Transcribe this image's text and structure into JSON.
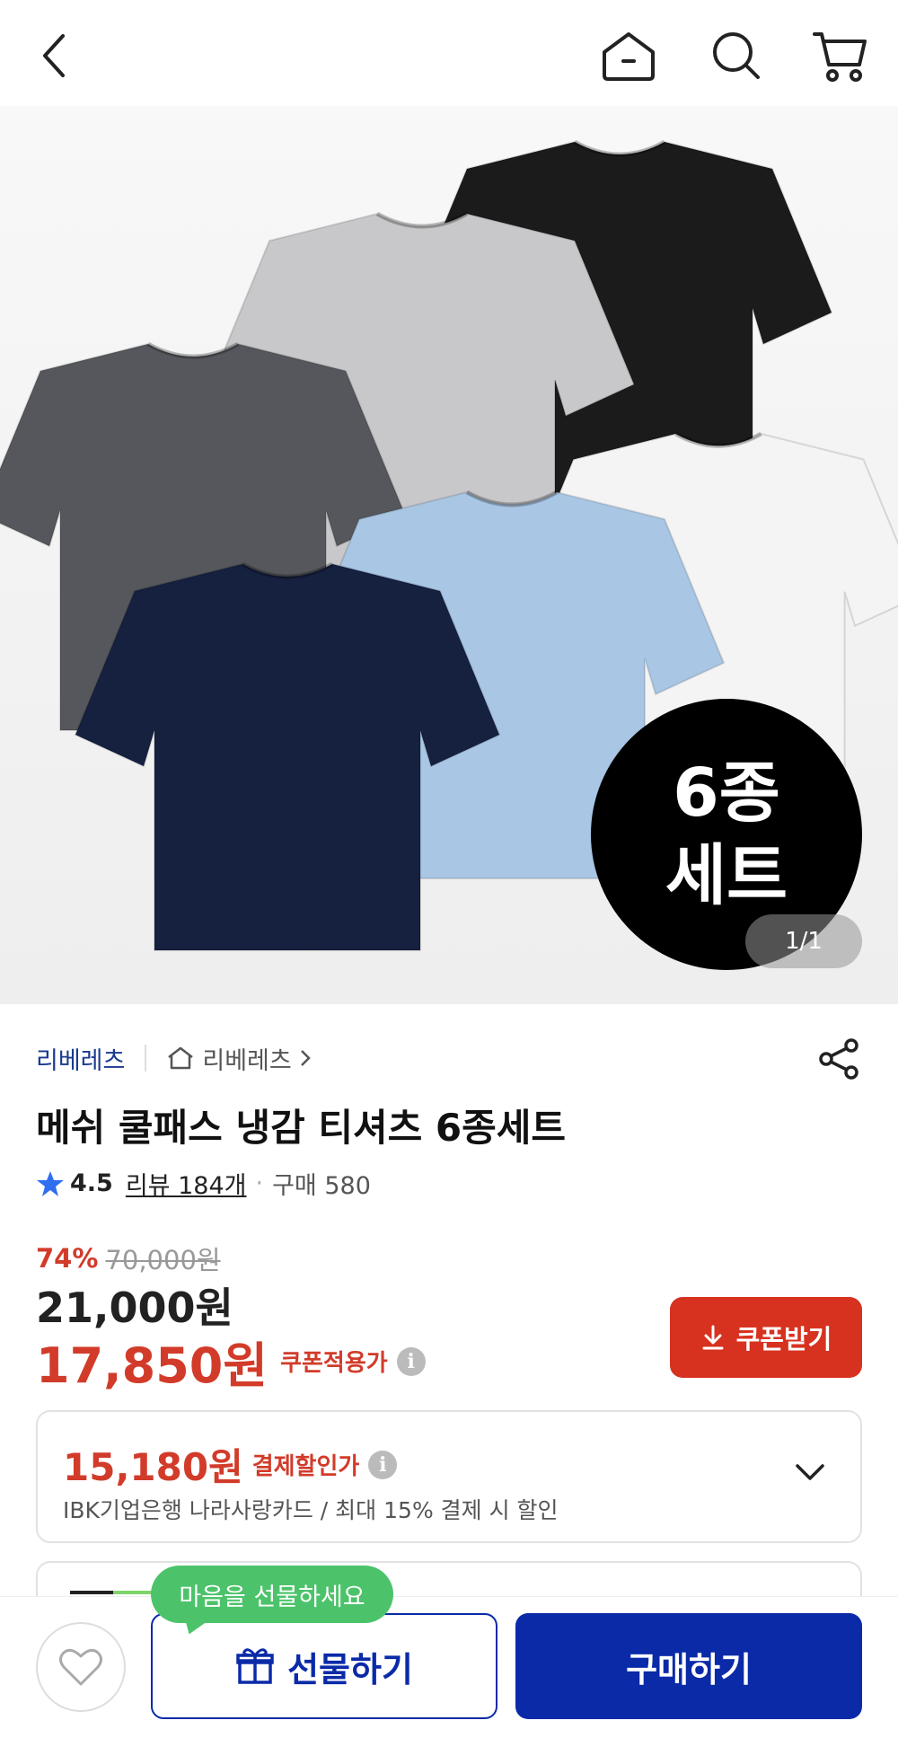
{
  "hero": {
    "badge_line1": "6종",
    "badge_line2": "세트",
    "pager": "1/1"
  },
  "product": {
    "brand": "리베레츠",
    "store": "리베레츠",
    "title": "메쉬 쿨패스 냉감 티셔츠 6종세트",
    "rating": "4.5",
    "review_link": "리뷰 184개",
    "purchase_count": "구매 580",
    "discount_rate": "74%",
    "original_price": "70,000원",
    "sale_price": "21,000원",
    "coupon_price": "17,850원",
    "coupon_price_label": "쿠폰적용가",
    "coupon_button": "쿠폰받기"
  },
  "payment": {
    "price": "15,180원",
    "label": "결제할인가",
    "description": "IBK기업은행 나라사랑카드 / 최대 15% 결제 시 할인"
  },
  "bottom": {
    "tooltip": "마음을 선물하세요",
    "gift_button": "선물하기",
    "buy_button": "구매하기"
  },
  "colors": {
    "primary_blue": "#0a2aa8",
    "discount_red": "#d23b2a",
    "coupon_red": "#d7321f",
    "tooltip_green": "#4cc36a"
  },
  "shirt_colors": [
    "#1b1b1c",
    "#c8c8ca",
    "#55575c",
    "#f4f4f4",
    "#a9c6e4",
    "#16213f"
  ]
}
